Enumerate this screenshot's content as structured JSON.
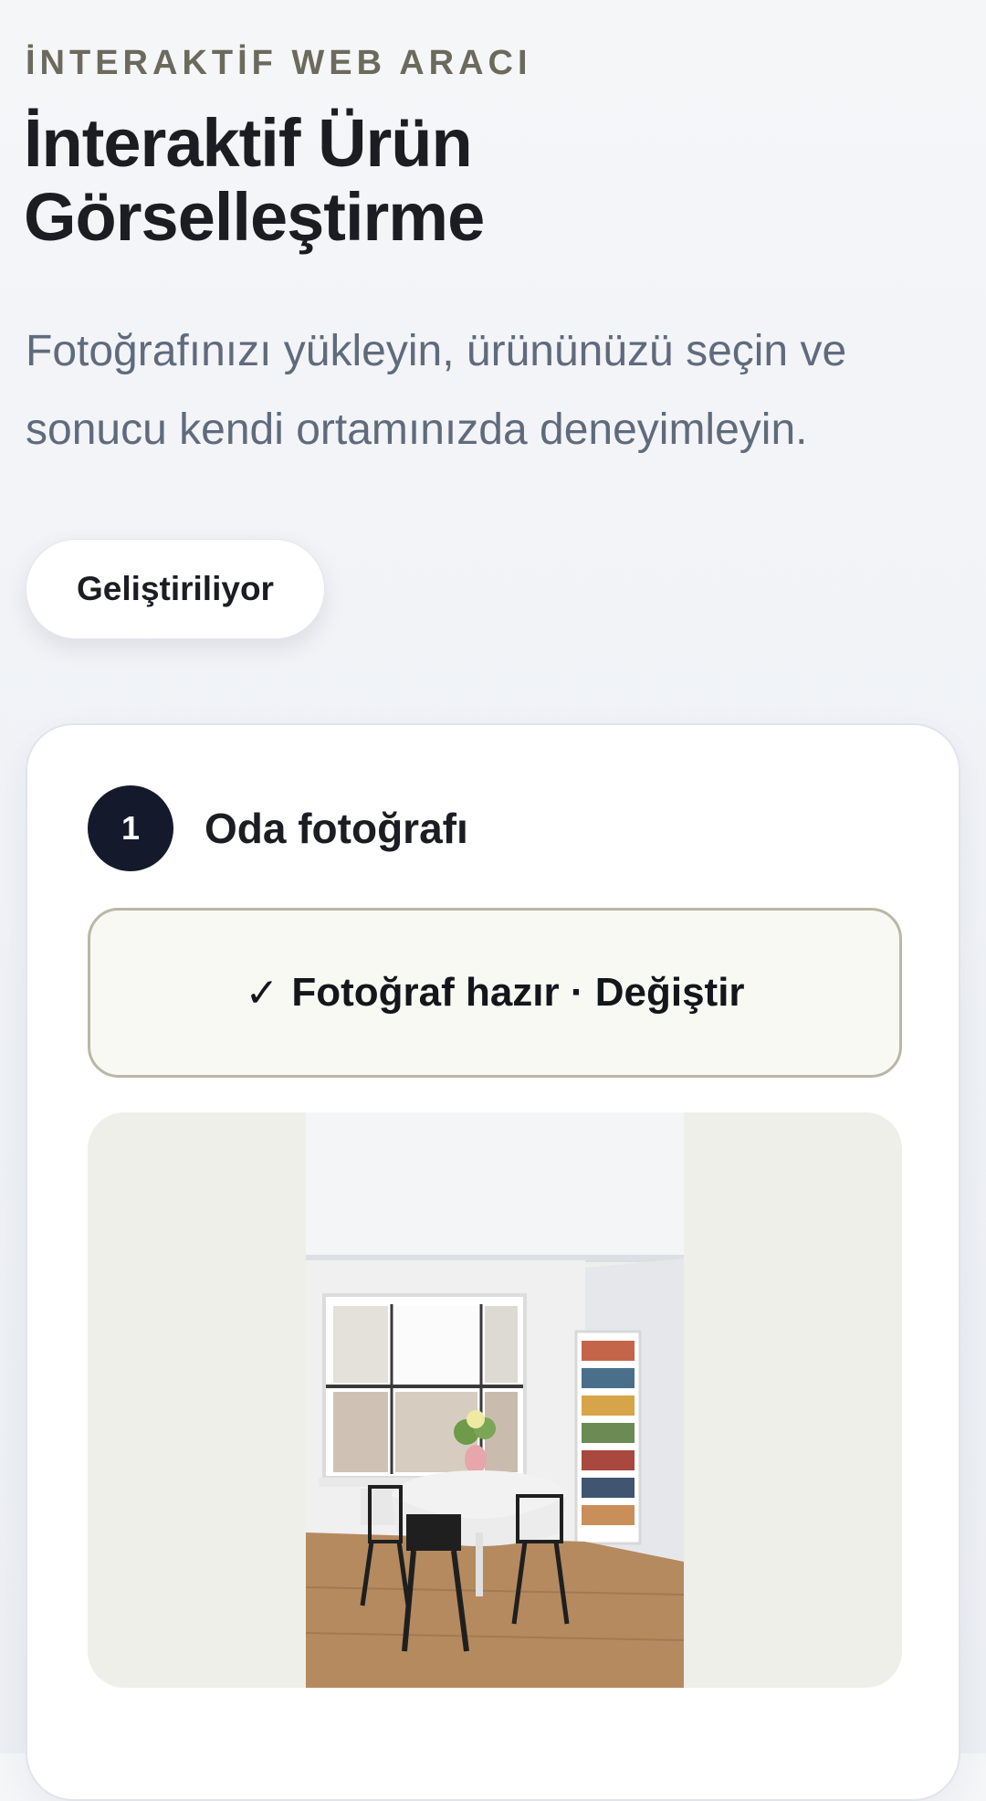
{
  "header": {
    "eyebrow": "İNTERAKTİF WEB ARACI",
    "title": "İnteraktif Ürün Görselleştirme",
    "subtitle": "Fotoğrafınızı yükleyin, ürününüzü seçin ve sonucu kendi ortamınızda deneyimleyin."
  },
  "status": {
    "label": "Geliştiriliyor"
  },
  "step1": {
    "number": "1",
    "title": "Oda fotoğrafı",
    "upload_check": "✓",
    "upload_label": "Fotoğraf hazır · Değiştir"
  },
  "preview": {
    "icon": "room-photo-image"
  },
  "colors": {
    "accent_dark": "#141a2b",
    "eyebrow": "#6b6a5c",
    "subtitle": "#5f6b7d",
    "upload_bg": "#f9f9f4",
    "upload_border": "#b9b7a6",
    "preview_bg": "#efefea"
  }
}
